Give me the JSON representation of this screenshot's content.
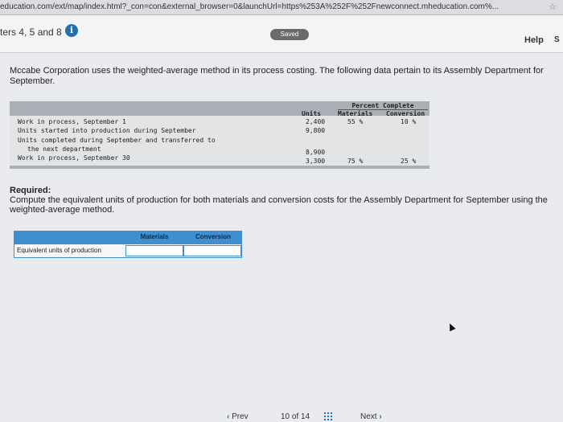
{
  "browser": {
    "url": "education.com/ext/map/index.html?_con=con&external_browser=0&launchUrl=https%253A%252F%252Fnewconnect.mheducation.com%..."
  },
  "header": {
    "chapter": "ters 4, 5 and 8",
    "info_icon": "i",
    "saved": "Saved",
    "help": "Help",
    "help2": "S"
  },
  "question": {
    "intro": "Mccabe Corporation uses the weighted-average method in its process costing. The following data pertain to its Assembly Department for September.",
    "table": {
      "percent_complete_label": "Percent Complete",
      "col_units": "Units",
      "col_materials": "Materials",
      "col_conversion": "Conversion",
      "rows": [
        {
          "label": "Work in process, September 1",
          "units": "2,400",
          "materials": "55 %",
          "conversion": "10 %"
        },
        {
          "label": "Units started into production during September",
          "units": "9,800",
          "materials": "",
          "conversion": ""
        },
        {
          "label": "Units completed during September and transferred to",
          "units": "",
          "materials": "",
          "conversion": ""
        },
        {
          "label": "the next department",
          "units": "8,900",
          "materials": "",
          "conversion": ""
        },
        {
          "label": "Work in process, September 30",
          "units": "3,300",
          "materials": "75 %",
          "conversion": "25 %"
        }
      ]
    },
    "required_label": "Required:",
    "required_text": "Compute the equivalent units of production for both materials and conversion costs for the Assembly Department for September using the weighted-average method.",
    "answer": {
      "col_materials": "Materials",
      "col_conversion": "Conversion",
      "row_label": "Equivalent units of production",
      "materials_value": "",
      "conversion_value": ""
    }
  },
  "footer": {
    "prev": "Prev",
    "page_current": "10",
    "page_of": "of",
    "page_total": "14",
    "next": "Next"
  }
}
